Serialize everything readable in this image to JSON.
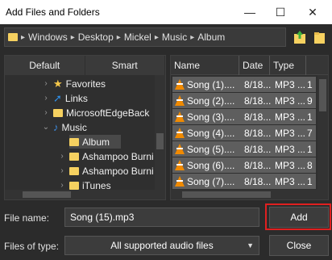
{
  "window": {
    "title": "Add Files and Folders"
  },
  "address": {
    "crumbs": [
      "Windows",
      "Desktop",
      "Mickel",
      "Music",
      "Album"
    ]
  },
  "tabs": [
    "Default",
    "Smart"
  ],
  "tree": [
    {
      "label": "Favorites",
      "icon": "star-icon"
    },
    {
      "label": "Links",
      "icon": "link-arrow-icon"
    },
    {
      "label": "MicrosoftEdgeBack",
      "icon": "folder-icon"
    },
    {
      "label": "Music",
      "icon": "music-note-icon"
    },
    {
      "label": "Album",
      "icon": "folder-icon"
    },
    {
      "label": "Ashampoo Burni",
      "icon": "folder-icon"
    },
    {
      "label": "Ashampoo Burni",
      "icon": "folder-icon"
    },
    {
      "label": "iTunes",
      "icon": "folder-icon"
    }
  ],
  "filelist": {
    "columns": [
      "Name",
      "Date",
      "Type"
    ],
    "rows": [
      {
        "name": "Song (1)....",
        "date": "8/18...",
        "type": "MP3 ...",
        "extra": "1"
      },
      {
        "name": "Song (2)....",
        "date": "8/18...",
        "type": "MP3 ...",
        "extra": "9"
      },
      {
        "name": "Song (3)....",
        "date": "8/18...",
        "type": "MP3 ...",
        "extra": "1"
      },
      {
        "name": "Song (4)....",
        "date": "8/18...",
        "type": "MP3 ...",
        "extra": "7"
      },
      {
        "name": "Song (5)....",
        "date": "8/18...",
        "type": "MP3 ...",
        "extra": "1"
      },
      {
        "name": "Song (6)....",
        "date": "8/18...",
        "type": "MP3 ...",
        "extra": "8"
      },
      {
        "name": "Song (7)....",
        "date": "8/18...",
        "type": "MP3 ...",
        "extra": "1"
      }
    ]
  },
  "form": {
    "file_name_label": "File name:",
    "file_name_value": "Song (15).mp3",
    "file_type_label": "Files of type:",
    "file_type_value": "All supported audio files",
    "add_label": "Add",
    "close_label": "Close"
  },
  "colors": {
    "accent_highlight": "#e02020",
    "folder": "#f6d160",
    "vlc_cone": "#f08a00"
  }
}
